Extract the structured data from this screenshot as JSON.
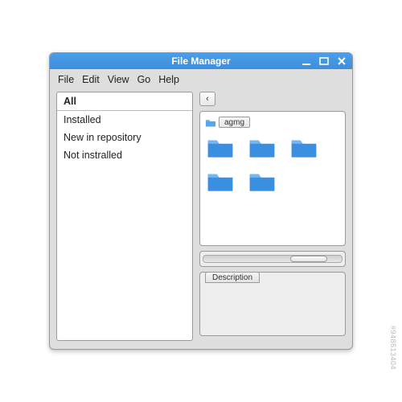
{
  "window": {
    "title": "File Manager"
  },
  "menu": {
    "items": [
      "File",
      "Edit",
      "View",
      "Go",
      "Help"
    ]
  },
  "sidebar": {
    "items": [
      {
        "label": "All",
        "selected": true
      },
      {
        "label": "Installed",
        "selected": false
      },
      {
        "label": "New in repository",
        "selected": false
      },
      {
        "label": "Not instralled",
        "selected": false
      }
    ]
  },
  "nav": {
    "back_symbol": "‹"
  },
  "breadcrumb": {
    "current": "agmg"
  },
  "folders": {
    "count": 5
  },
  "description": {
    "tab_label": "Description"
  },
  "colors": {
    "titlebar": "#4a9eea",
    "folder": "#3b8fe0"
  }
}
